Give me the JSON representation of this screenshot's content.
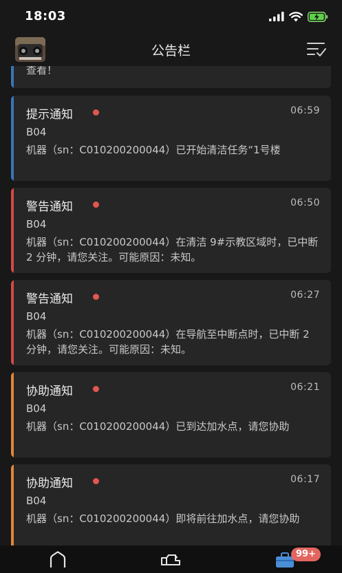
{
  "status": {
    "time": "18:03"
  },
  "header": {
    "title": "公告栏"
  },
  "partial_card": {
    "message": "查看！",
    "accent": "#3a76b7"
  },
  "notifications": [
    {
      "title": "提示通知",
      "time": "06:59",
      "device": "B04",
      "message": "机器（sn：C010200200044）已开始清洁任务“1号楼",
      "accent": "#3a76b7"
    },
    {
      "title": "警告通知",
      "time": "06:50",
      "device": "B04",
      "message": "机器（sn：C010200200044）在清洁 9#示教区域时，已中断 2 分钟，请您关注。可能原因：未知。",
      "accent": "#d34a45"
    },
    {
      "title": "警告通知",
      "time": "06:27",
      "device": "B04",
      "message": "机器（sn：C010200200044）在导航至中断点时，已中断 2 分钟，请您关注。可能原因：未知。",
      "accent": "#d34a45"
    },
    {
      "title": "协助通知",
      "time": "06:21",
      "device": "B04",
      "message": "机器（sn：C010200200044）已到达加水点，请您协助",
      "accent": "#e0873a"
    },
    {
      "title": "协助通知",
      "time": "06:17",
      "device": "B04",
      "message": "机器（sn：C010200200044）即将前往加水点，请您协助",
      "accent": "#e0873a"
    }
  ],
  "unread_dot_color": "#e0574f",
  "tabbar": {
    "badge": "99+",
    "tabs": [
      {
        "icon": "home-icon"
      },
      {
        "icon": "robot-icon"
      },
      {
        "icon": "briefcase-icon"
      }
    ]
  }
}
